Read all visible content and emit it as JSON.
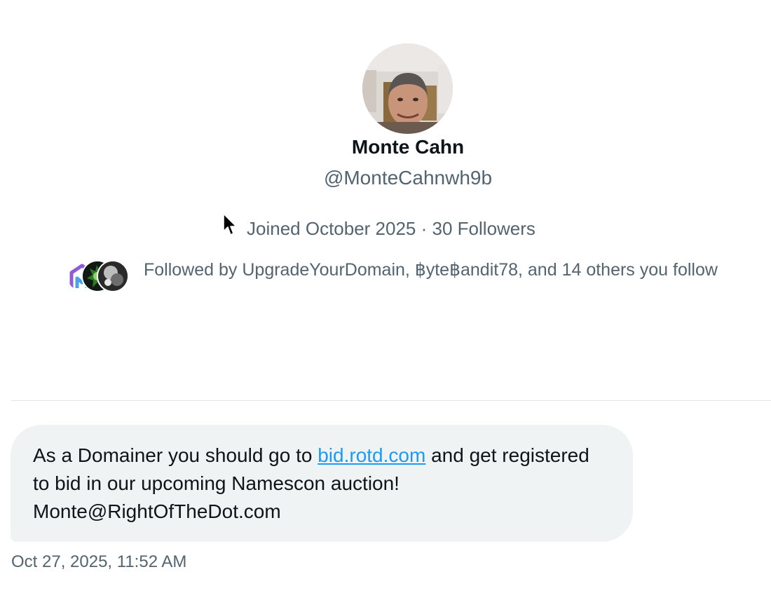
{
  "profile": {
    "display_name": "Monte Cahn",
    "handle": "@MonteCahnwh9b",
    "joined": "Joined October 2025",
    "separator": "·",
    "followers": "30 Followers",
    "followed_by": {
      "prefix": "Followed by ",
      "users": [
        "UpgradeYourDomain",
        "฿yte฿andit78"
      ],
      "joiner": ", ",
      "suffix": ", and 14 others you follow"
    }
  },
  "message": {
    "text_before_link": "As a Domainer you should go to ",
    "link_text": "bid.rotd.com",
    "text_after_link": " and get registered to bid in our upcoming Namescon auction! Monte@RightOfTheDot.com",
    "timestamp": "Oct 27, 2025, 11:52 AM"
  },
  "colors": {
    "primary_text": "#0f1419",
    "secondary_text": "#536471",
    "link": "#1d9bf0",
    "bubble_bg": "#eff3f4",
    "divider": "#e3e6e8"
  },
  "icons": {
    "cursor": "mouse-pointer-icon",
    "avatar": "profile-photo",
    "followers": [
      "upgradeyourdomain-avatar",
      "bytebandit-avatar",
      "follower-avatar-3"
    ]
  }
}
